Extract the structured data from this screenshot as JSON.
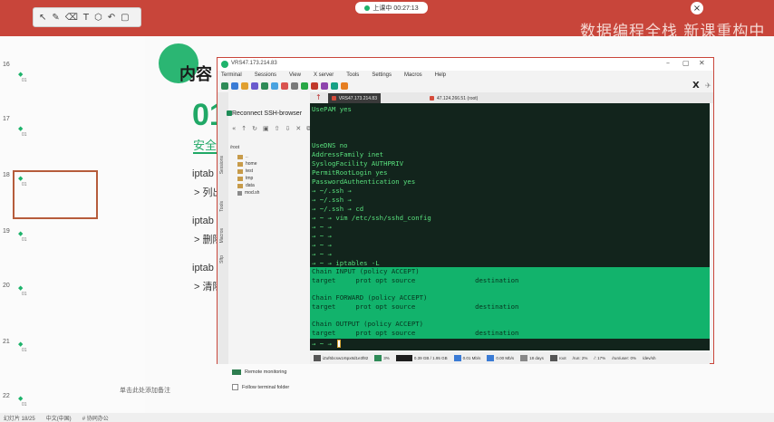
{
  "recording": {
    "label": "上课中 00:27:13"
  },
  "watermark": "数据编程全栈 新课重构中",
  "slide_thumbs": [
    {
      "num": "16",
      "sub": "01"
    },
    {
      "num": "17",
      "sub": "01"
    },
    {
      "num": "18",
      "sub": "01"
    },
    {
      "num": "19",
      "sub": "01"
    },
    {
      "num": "20",
      "sub": "01"
    },
    {
      "num": "21",
      "sub": "01"
    },
    {
      "num": "22",
      "sub": "01"
    }
  ],
  "slide": {
    "title": "内容",
    "big_number": "01",
    "subtitle": "安全",
    "lines": [
      {
        "head": "iptab",
        "item": "> 列出"
      },
      {
        "head": "iptab",
        "item": "> 删除"
      },
      {
        "head": "iptab",
        "item": "> 清除"
      }
    ],
    "note": "单击此处添加备注"
  },
  "statusbar": [
    "幻灯片 18/25",
    "中文(中国)",
    "# 协同办公"
  ],
  "moba": {
    "title": "VRS47.173.214.83",
    "menu": [
      "Terminal",
      "Sessions",
      "View",
      "X server",
      "Tools",
      "Settings",
      "Macros",
      "Help"
    ],
    "sidebar": {
      "header": "Reconnect SSH-browser",
      "vtabs": [
        "Sessions",
        "Tools",
        "Macros",
        "Sftp"
      ],
      "files": [
        {
          "name": "/root",
          "kind": "folder"
        },
        {
          "name": "..",
          "kind": "up"
        },
        {
          "name": "home",
          "kind": "folder"
        },
        {
          "name": "test",
          "kind": "folder"
        },
        {
          "name": "tmp",
          "kind": "folder"
        },
        {
          "name": "data",
          "kind": "folder"
        },
        {
          "name": "mod.sh",
          "kind": "file"
        }
      ],
      "remote_monitoring": "Remote monitoring",
      "follow_folder": "Follow terminal folder"
    },
    "tabs": [
      {
        "label": "VRS47.173.214.83"
      },
      {
        "label": "47.124.266.51 (root)"
      }
    ],
    "terminal_lines": [
      "UsePAM yes",
      "",
      "",
      "",
      "UseDNS no",
      "AddressFamily inet",
      "SyslogFacility AUTHPRIV",
      "PermitRootLogin yes",
      "PasswordAuthentication yes",
      "→ ~/.ssh →",
      "→ ~/.ssh →",
      "→ ~/.ssh → cd",
      "→ ~ → vim /etc/ssh/sshd_config",
      "→ ~ →",
      "→ ~ →",
      "→ ~ →",
      "→ ~ →",
      "→ ~ → iptables -L"
    ],
    "iptables_output": [
      "Chain INPUT (policy ACCEPT)",
      "target     prot opt source               destination",
      "",
      "Chain FORWARD (policy ACCEPT)",
      "target     prot opt source               destination",
      "",
      "Chain OUTPUT (policy ACCEPT)",
      "target     prot opt source               destination"
    ],
    "prompt_last": "→ ~ →",
    "status": [
      "iZuf6bcsw1r6px8d1e3f82",
      "3%",
      "0.39 GB / 1.95 GB",
      "0.01 Mb/s",
      "0.00 Mb/s",
      "18 days",
      "root",
      "/run: 2%",
      "/: 17%",
      "/run/user: 0%",
      "/dev/sh"
    ]
  }
}
